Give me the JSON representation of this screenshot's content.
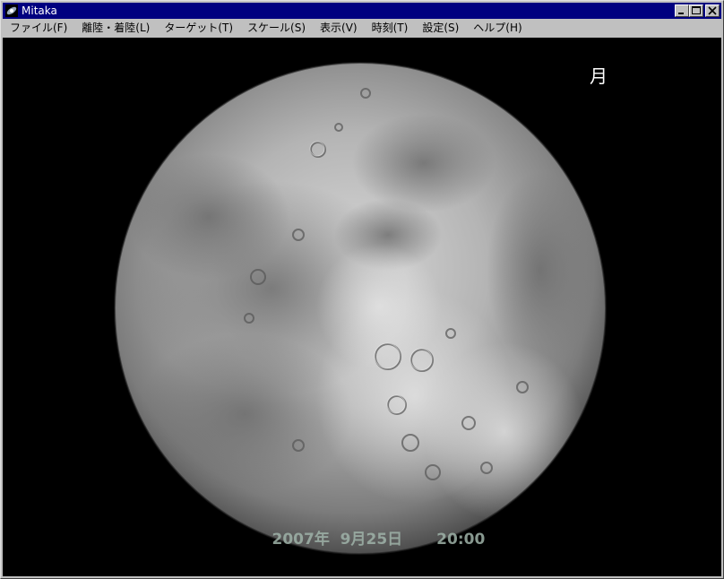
{
  "window": {
    "title": "Mitaka",
    "controls": {
      "minimize": "minimize-icon",
      "maximize": "maximize-icon",
      "close": "close-icon"
    }
  },
  "menu": [
    {
      "label": "ファイル(F)"
    },
    {
      "label": "離陸・着陸(L)"
    },
    {
      "label": "ターゲット(T)"
    },
    {
      "label": "スケール(S)"
    },
    {
      "label": "表示(V)"
    },
    {
      "label": "時刻(T)"
    },
    {
      "label": "設定(S)"
    },
    {
      "label": "ヘルプ(H)"
    }
  ],
  "view": {
    "target_label": "月",
    "date": "2007年  9月25日",
    "time": "20:00",
    "body_icon": "moon-globe",
    "colors": {
      "background": "#000000",
      "titlebar": "#000080",
      "overlay_text": "#9fb3a9"
    }
  }
}
